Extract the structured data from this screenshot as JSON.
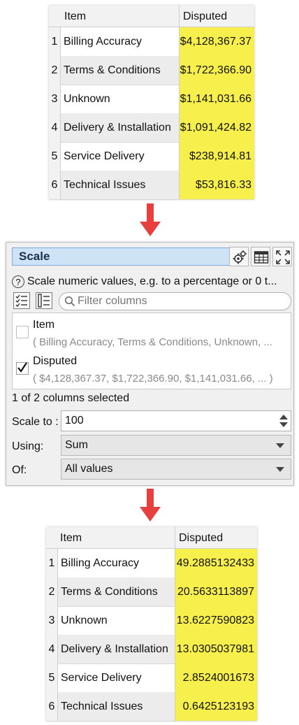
{
  "input_table": {
    "headers": [
      "Item",
      "Disputed"
    ],
    "rows": [
      {
        "index": "1",
        "item": "Billing Accuracy",
        "value": "$4,128,367.37"
      },
      {
        "index": "2",
        "item": "Terms & Conditions",
        "value": "$1,722,366.90"
      },
      {
        "index": "3",
        "item": "Unknown",
        "value": "$1,141,031.66"
      },
      {
        "index": "4",
        "item": "Delivery & Installation",
        "value": "$1,091,424.82"
      },
      {
        "index": "5",
        "item": "Service Delivery",
        "value": "$238,914.81"
      },
      {
        "index": "6",
        "item": "Technical Issues",
        "value": "$53,816.33"
      }
    ]
  },
  "dialog": {
    "title": "Scale",
    "description": "Scale numeric values, e.g. to a percentage or 0 t...",
    "filter_placeholder": "Filter columns",
    "columns": [
      {
        "name": "Item",
        "sample": "( Billing Accuracy, Terms & Conditions, Unknown, ...",
        "checked": false
      },
      {
        "name": "Disputed",
        "sample": "( $4,128,367.37, $1,722,366.90, $1,141,031.66, ... )",
        "checked": true
      }
    ],
    "selection_info": "1 of 2 columns selected",
    "scale_to_label": "Scale to :",
    "scale_to_value": "100",
    "using_label": "Using:",
    "using_value": "Sum",
    "of_label": "Of:",
    "of_value": "All values"
  },
  "output_table": {
    "headers": [
      "Item",
      "Disputed"
    ],
    "rows": [
      {
        "index": "1",
        "item": "Billing Accuracy",
        "value": "49.2885132433"
      },
      {
        "index": "2",
        "item": "Terms & Conditions",
        "value": "20.5633113897"
      },
      {
        "index": "3",
        "item": "Unknown",
        "value": "13.6227590823"
      },
      {
        "index": "4",
        "item": "Delivery & Installation",
        "value": "13.0305037981"
      },
      {
        "index": "5",
        "item": "Service Delivery",
        "value": "2.8524001673"
      },
      {
        "index": "6",
        "item": "Technical Issues",
        "value": "0.6425123193"
      }
    ]
  },
  "colors": {
    "highlight": "#f7ef4c",
    "arrow": "#e8403f",
    "title_bg": "#cfe3f7"
  }
}
